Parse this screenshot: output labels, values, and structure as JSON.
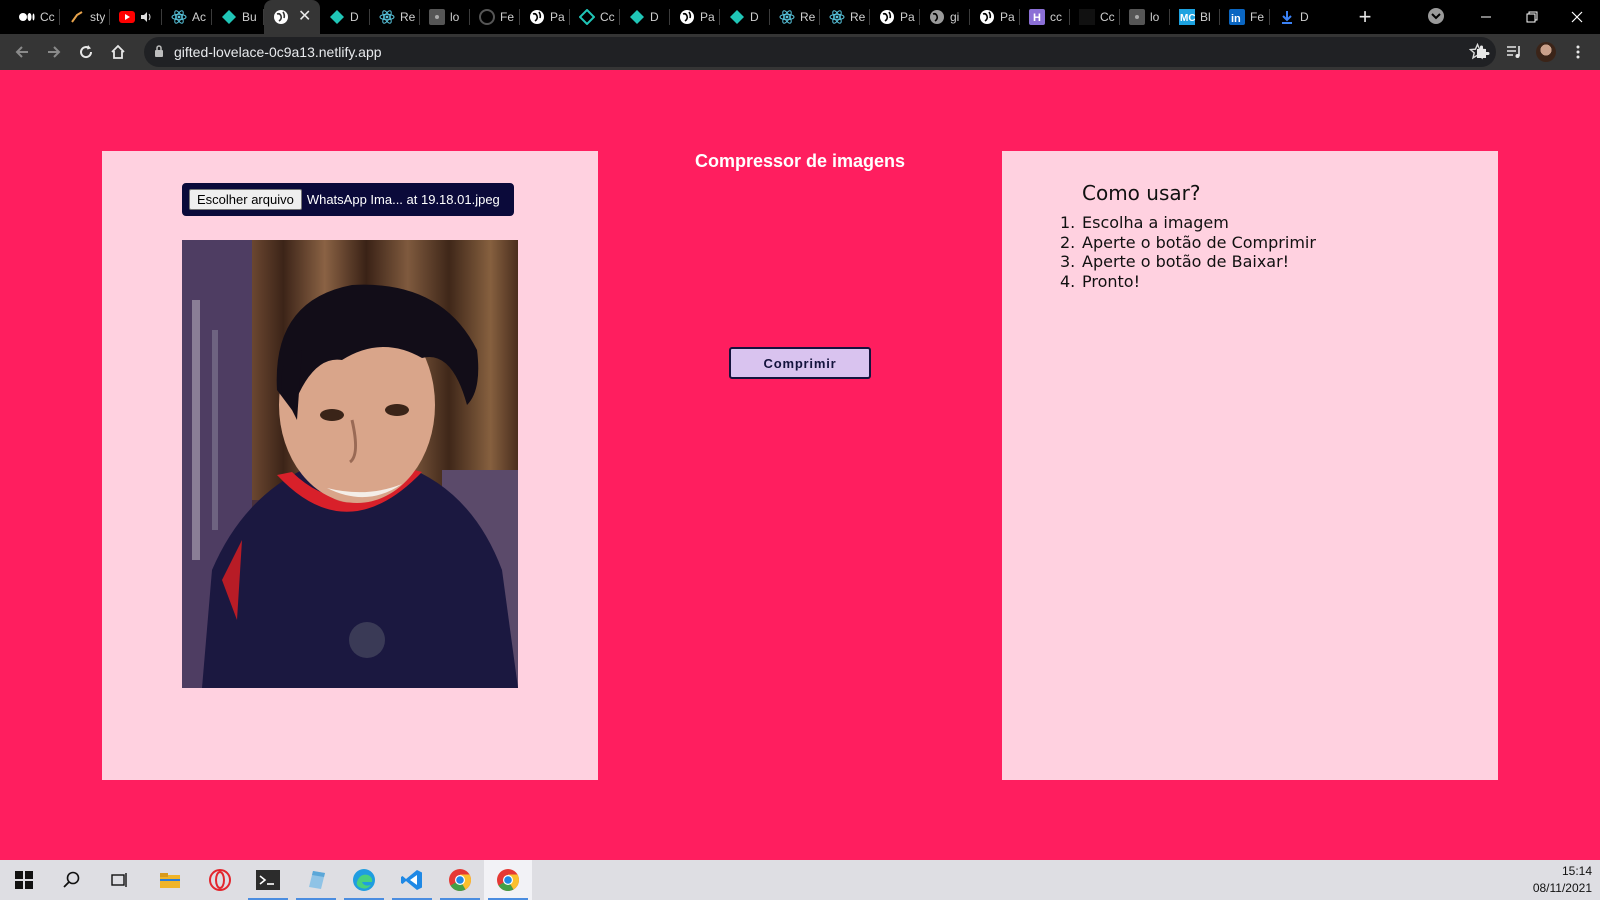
{
  "browser": {
    "tabs": [
      {
        "title": "Cc",
        "icon": "tab-favicon-medium"
      },
      {
        "title": "sty",
        "icon": "tab-favicon-styled"
      },
      {
        "title": "",
        "icon": "tab-favicon-youtube-audio"
      },
      {
        "title": "Ac",
        "icon": "tab-favicon-react"
      },
      {
        "title": "Bu",
        "icon": "tab-favicon-netlify"
      },
      {
        "title": "",
        "icon": "tab-favicon-globe",
        "active": true
      },
      {
        "title": "D",
        "icon": "tab-favicon-netlify"
      },
      {
        "title": "Re",
        "icon": "tab-favicon-react"
      },
      {
        "title": "lo",
        "icon": "tab-favicon-react"
      },
      {
        "title": "Fe",
        "icon": "tab-favicon-github"
      },
      {
        "title": "Pa",
        "icon": "tab-favicon-globe"
      },
      {
        "title": "Cc",
        "icon": "tab-favicon-netlify-outline"
      },
      {
        "title": "D",
        "icon": "tab-favicon-netlify"
      },
      {
        "title": "Pa",
        "icon": "tab-favicon-globe"
      },
      {
        "title": "D",
        "icon": "tab-favicon-netlify"
      },
      {
        "title": "Re",
        "icon": "tab-favicon-react"
      },
      {
        "title": "Re",
        "icon": "tab-favicon-react"
      },
      {
        "title": "Pa",
        "icon": "tab-favicon-globe"
      },
      {
        "title": "gi",
        "icon": "tab-favicon-globe-grey"
      },
      {
        "title": "Pa",
        "icon": "tab-favicon-globe"
      },
      {
        "title": "cc",
        "icon": "tab-favicon-heroku"
      },
      {
        "title": "Cc",
        "icon": "tab-favicon-dark"
      },
      {
        "title": "lo",
        "icon": "tab-favicon-react"
      },
      {
        "title": "Bl",
        "icon": "tab-favicon-mc"
      },
      {
        "title": "Fe",
        "icon": "tab-favicon-linkedin"
      },
      {
        "title": "D",
        "icon": "tab-favicon-download"
      }
    ],
    "url": "gifted-lovelace-0c9a13.netlify.app"
  },
  "page": {
    "title": "Compressor de imagens",
    "file_button": "Escolher arquivo",
    "file_name": "WhatsApp Ima... at 19.18.01.jpeg",
    "compress_button": "Comprimir",
    "howto_title": "Como usar?",
    "steps": [
      {
        "num": "1.",
        "text": "Escolha a imagem"
      },
      {
        "num": "2.",
        "text": "Aperte o botão de Comprimir"
      },
      {
        "num": "3.",
        "text": "Aperte o botão de Baixar!"
      },
      {
        "num": "4.",
        "text": "Pronto!"
      }
    ]
  },
  "taskbar": {
    "time": "15:14",
    "date": "08/11/2021",
    "apps": [
      "windows-start-icon",
      "search-icon",
      "task-view-icon",
      "file-explorer-icon",
      "opera-icon",
      "terminal-icon",
      "notepad-icon",
      "edge-icon",
      "vscode-icon",
      "chrome-icon",
      "chrome-icon"
    ]
  },
  "colors": {
    "page_background": "#ff1e5f",
    "panel_background": "#ffd1e0",
    "button_background": "#d9c3ef",
    "button_border": "#14133d"
  }
}
